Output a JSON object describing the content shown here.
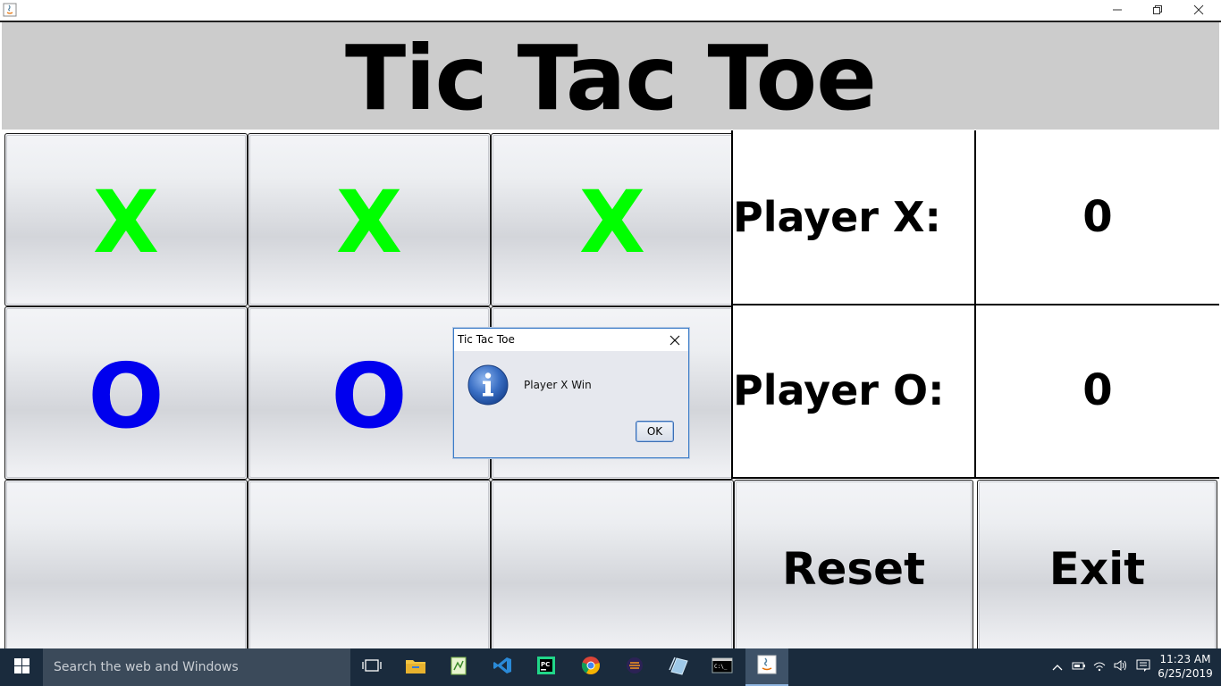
{
  "window": {
    "title_icon": "java-icon",
    "controls": [
      "minimize-icon",
      "restore-icon",
      "close-icon"
    ]
  },
  "game": {
    "title": "Tic Tac Toe",
    "board": [
      [
        "X",
        "X",
        "X"
      ],
      [
        "O",
        "O",
        ""
      ],
      [
        "",
        "",
        ""
      ]
    ],
    "player_x_label": "Player X:",
    "player_x_score": "0",
    "player_o_label": "Player O:",
    "player_o_score": "0",
    "reset_label": "Reset",
    "exit_label": "Exit",
    "colors": {
      "x": "#00ff00",
      "o": "#0000ee",
      "header_bg": "#cccccc"
    }
  },
  "dialog": {
    "title": "Tic Tac Toe",
    "icon": "info-icon",
    "message": "Player X Win",
    "ok_label": "OK"
  },
  "taskbar": {
    "search_placeholder": "Search the web and Windows",
    "pinned": [
      "task-view-icon",
      "file-explorer-icon",
      "notepad-plus-icon",
      "vscode-icon",
      "pycharm-icon",
      "chrome-icon",
      "eclipse-icon",
      "files-icon",
      "terminal-icon",
      "java-icon"
    ],
    "active_app": "java-icon",
    "clock_time": "11:23 AM",
    "clock_date": "6/25/2019"
  }
}
